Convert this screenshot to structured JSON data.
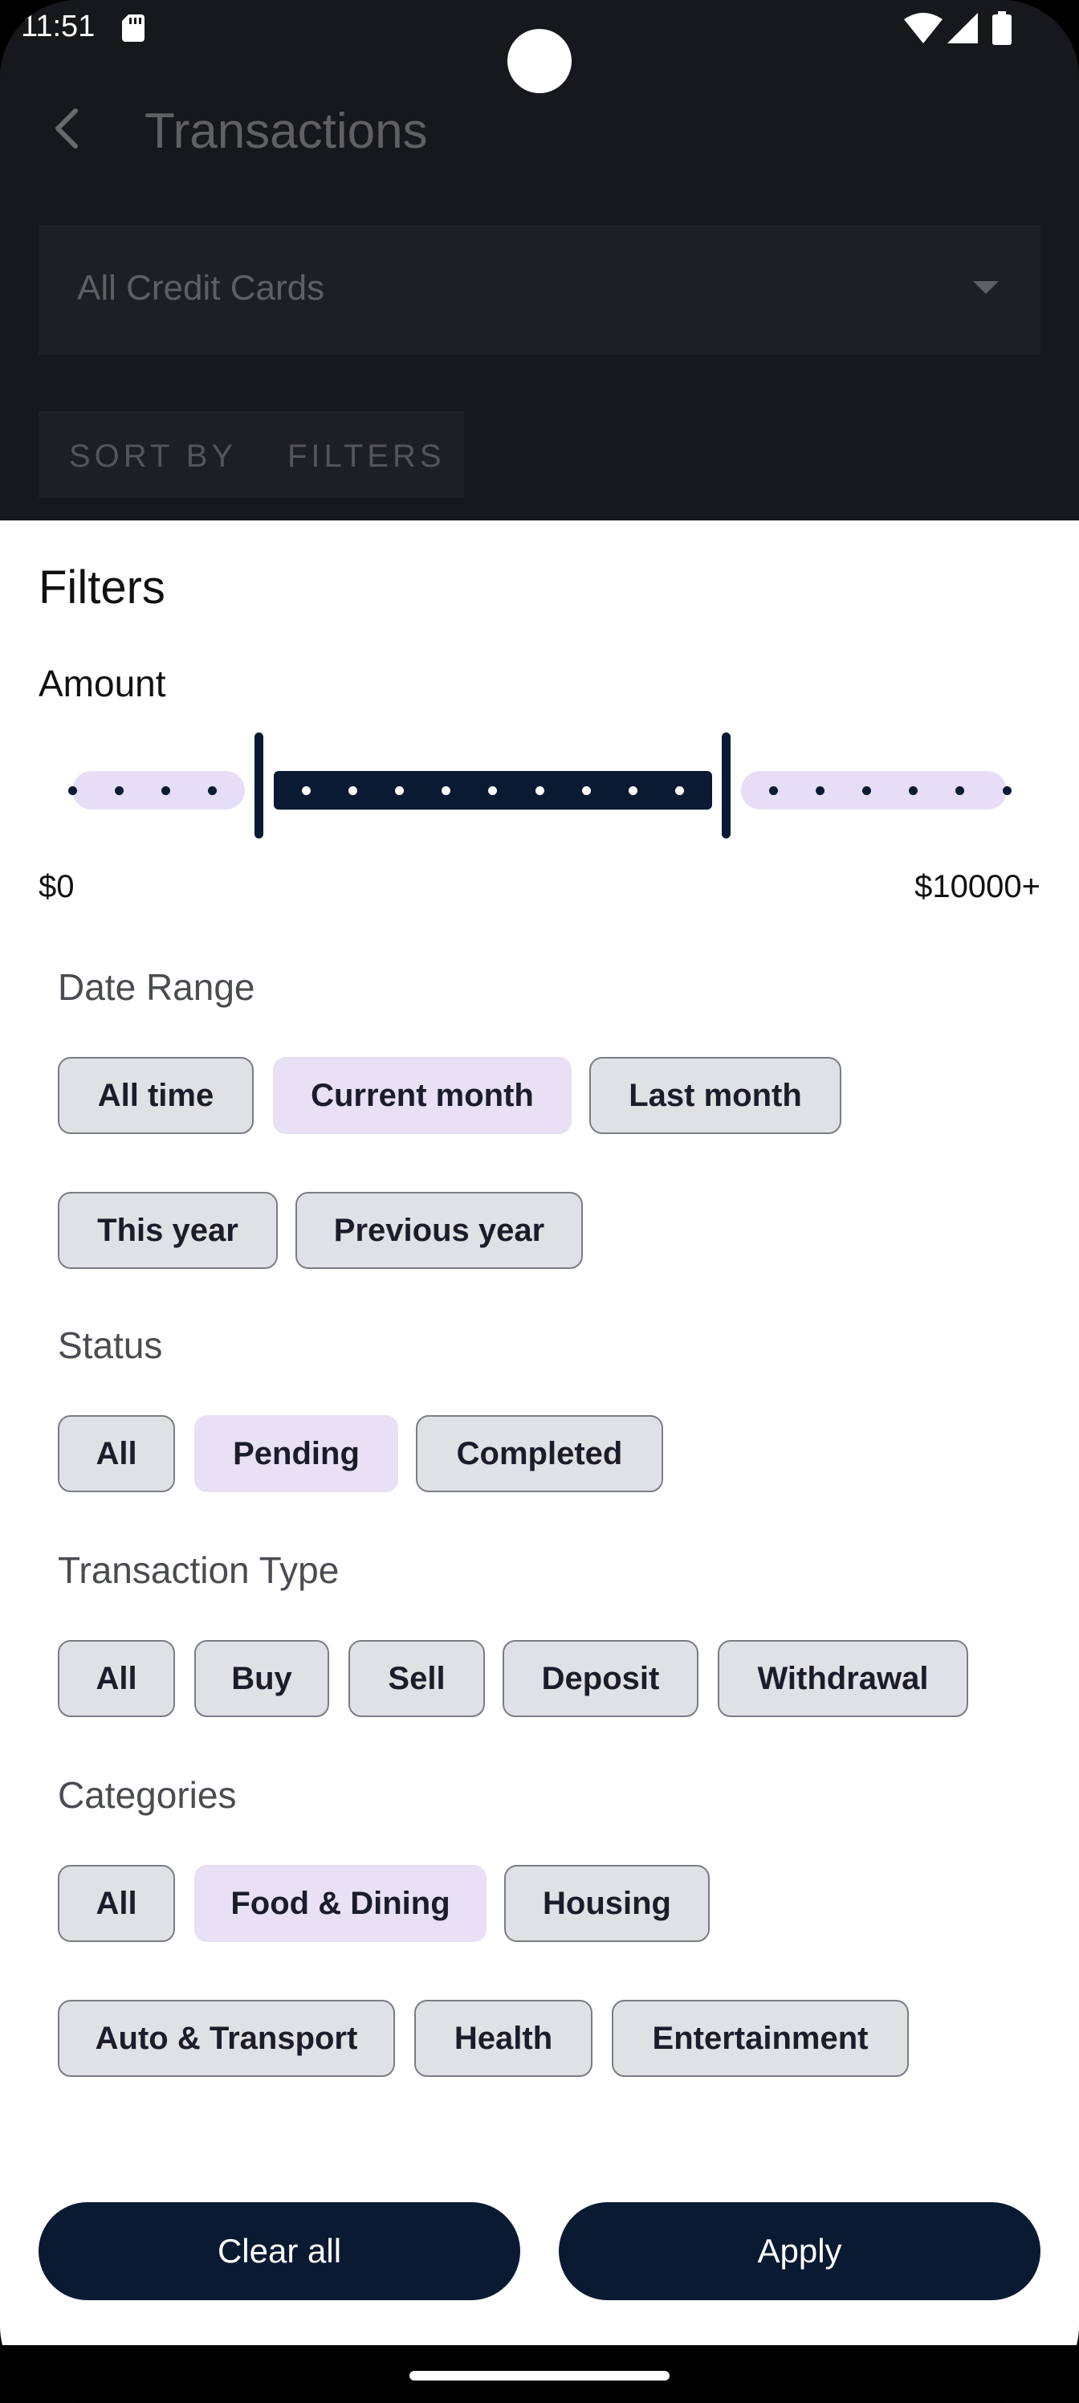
{
  "status_bar": {
    "time": "11:51"
  },
  "background": {
    "title": "Transactions",
    "select_label": "All Credit Cards",
    "tabs": [
      {
        "label": "SORT BY"
      },
      {
        "label": "FILTERS"
      }
    ]
  },
  "sheet": {
    "title": "Filters",
    "amount": {
      "label": "Amount",
      "min_label": "$0",
      "max_label": "$10000+",
      "selected_range_fraction": [
        0.2,
        0.7
      ]
    },
    "date_range": {
      "label": "Date Range",
      "chips": [
        {
          "label": "All time",
          "selected": false
        },
        {
          "label": "Current month",
          "selected": true
        },
        {
          "label": "Last month",
          "selected": false
        },
        {
          "label": "This year",
          "selected": false
        },
        {
          "label": "Previous year",
          "selected": false
        }
      ]
    },
    "status": {
      "label": "Status",
      "chips": [
        {
          "label": "All",
          "selected": false
        },
        {
          "label": "Pending",
          "selected": true
        },
        {
          "label": "Completed",
          "selected": false
        }
      ]
    },
    "transaction_type": {
      "label": "Transaction Type",
      "chips": [
        {
          "label": "All",
          "selected": false
        },
        {
          "label": "Buy",
          "selected": false
        },
        {
          "label": "Sell",
          "selected": false
        },
        {
          "label": "Deposit",
          "selected": false
        },
        {
          "label": "Withdrawal",
          "selected": false
        }
      ]
    },
    "categories": {
      "label": "Categories",
      "chips": [
        {
          "label": "All",
          "selected": false
        },
        {
          "label": "Food & Dining",
          "selected": true
        },
        {
          "label": "Housing",
          "selected": false
        },
        {
          "label": "Auto & Transport",
          "selected": false
        },
        {
          "label": "Health",
          "selected": false
        },
        {
          "label": "Entertainment",
          "selected": false
        }
      ]
    },
    "buttons": {
      "clear_all": "Clear all",
      "apply": "Apply"
    }
  },
  "colors": {
    "primary": "#0a1a33",
    "chip_selected": "#e8e0f5",
    "chip_default": "#e0e1e5",
    "track_inactive": "#e6def6"
  }
}
